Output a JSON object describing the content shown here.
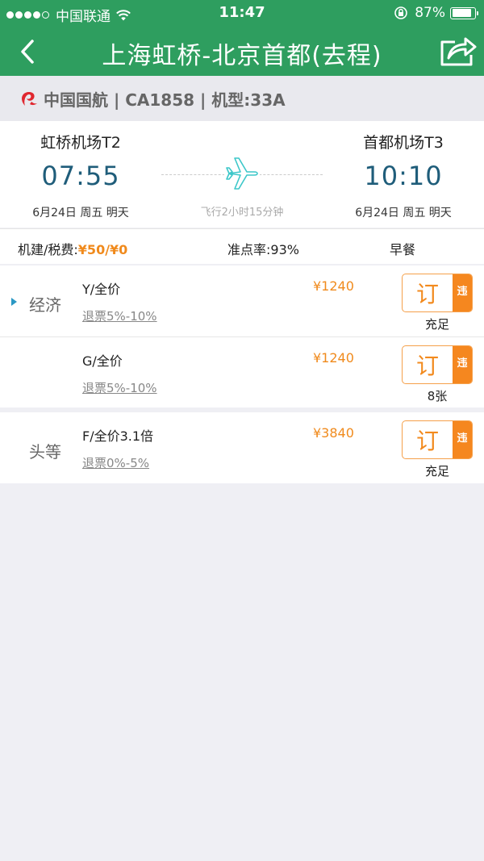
{
  "status_bar": {
    "carrier": "中国联通",
    "time": "11:47",
    "battery": "87%",
    "battery_level": 0.87
  },
  "nav": {
    "title": "上海虹桥-北京首都(去程)"
  },
  "airline": {
    "info": "中国国航 | CA1858 | 机型:33A",
    "brand_color": "#e0272f"
  },
  "flight": {
    "departure": {
      "airport": "虹桥机场T2",
      "time": "07:55",
      "date": "6月24日 周五 明天"
    },
    "arrival": {
      "airport": "首都机场T3",
      "time": "10:10",
      "date": "6月24日 周五 明天"
    },
    "duration": "飞行2小时15分钟"
  },
  "fees": {
    "label": "机建/税费:",
    "value": "¥50/¥0",
    "ontime": "准点率:93%",
    "meal": "早餐"
  },
  "book_label": "订",
  "violation_tag": "违",
  "cabins": [
    {
      "label": "经济",
      "fares": [
        {
          "name": "Y/全价",
          "refund": "退票5%-10%",
          "price": "¥1240",
          "stock": "充足"
        },
        {
          "name": "G/全价",
          "refund": "退票5%-10%",
          "price": "¥1240",
          "stock": "8张"
        }
      ]
    },
    {
      "label": "头等",
      "fares": [
        {
          "name": "F/全价3.1倍",
          "refund": "退票0%-5%",
          "price": "¥3840",
          "stock": "充足"
        }
      ]
    }
  ],
  "colors": {
    "primary_green": "#2e9e5f",
    "accent_orange": "#f08a1c",
    "time_blue": "#1f5d7a",
    "plane_cyan": "#3cc7c9"
  }
}
